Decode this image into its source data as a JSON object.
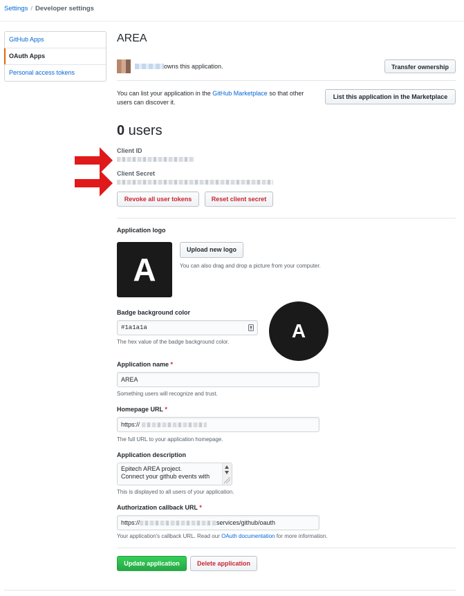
{
  "breadcrumb": {
    "root": "Settings",
    "current": "Developer settings"
  },
  "sidebar": {
    "items": [
      {
        "label": "GitHub Apps"
      },
      {
        "label": "OAuth Apps"
      },
      {
        "label": "Personal access tokens"
      }
    ]
  },
  "app": {
    "title": "AREA"
  },
  "owner": {
    "text": "owns this application.",
    "transfer_label": "Transfer ownership"
  },
  "marketplace": {
    "text_before": "You can list your application in the ",
    "link": "GitHub Marketplace",
    "text_after": " so that other users can discover it.",
    "button": "List this application in the Marketplace"
  },
  "users": {
    "count": "0",
    "label": " users"
  },
  "client_id": {
    "label": "Client ID"
  },
  "client_secret": {
    "label": "Client Secret"
  },
  "token_buttons": {
    "revoke": "Revoke all user tokens",
    "reset": "Reset client secret"
  },
  "logo": {
    "section_label": "Application logo",
    "letter": "A",
    "upload_label": "Upload new logo",
    "hint": "You can also drag and drop a picture from your computer."
  },
  "badge": {
    "label": "Badge background color",
    "value": "#1a1a1a",
    "hint": "The hex value of the badge background color.",
    "preview_letter": "A",
    "color": "#1a1a1a"
  },
  "app_name": {
    "label": "Application name",
    "required": "*",
    "value": "AREA",
    "hint": "Something users will recognize and trust."
  },
  "homepage": {
    "label": "Homepage URL",
    "required": "*",
    "value_prefix": "https://",
    "hint": "The full URL to your application homepage."
  },
  "description": {
    "label": "Application description",
    "line1": "Epitech AREA project.",
    "line2": "Connect your github events with",
    "hint": "This is displayed to all users of your application."
  },
  "callback": {
    "label": "Authorization callback URL",
    "required": "*",
    "value_prefix": "https://",
    "value_suffix": "services/github/oauth",
    "hint_before": "Your application's callback URL. Read our ",
    "hint_link": "OAuth documentation",
    "hint_after": " for more information."
  },
  "actions": {
    "update": "Update application",
    "delete": "Delete application"
  },
  "colors": {
    "accent_link": "#0366d6",
    "danger": "#cb2431",
    "primary": "#28a745",
    "arrow": "#e0191a",
    "selected_indicator": "#e36209"
  }
}
